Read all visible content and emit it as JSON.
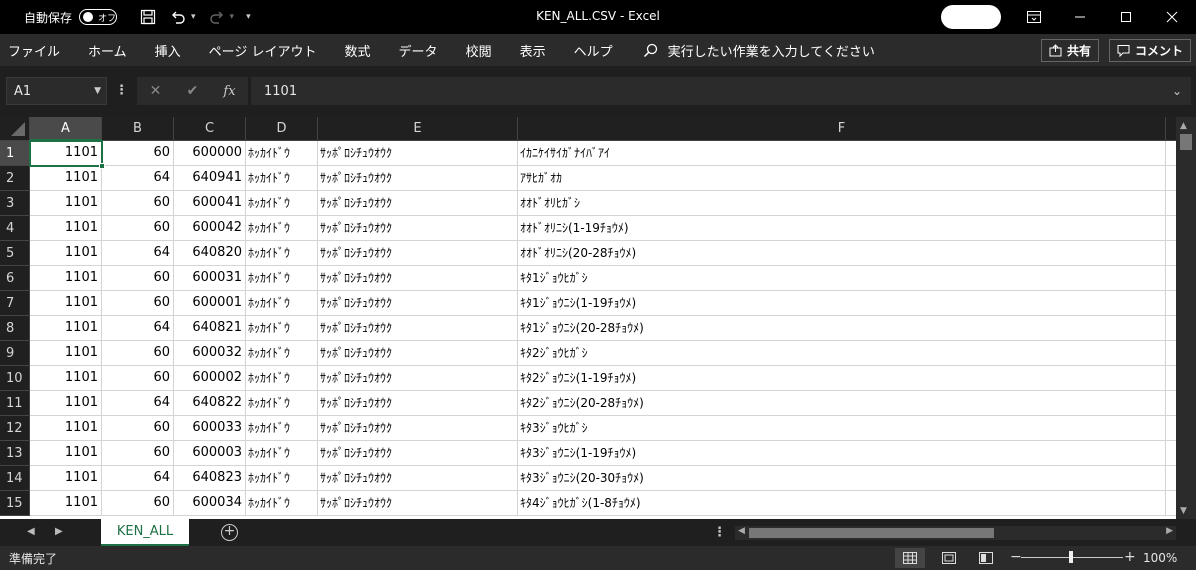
{
  "titlebar": {
    "autosave_label": "自動保存",
    "autosave_state": "オフ",
    "title": "KEN_ALL.CSV  -  Excel",
    "icons": [
      "save-icon",
      "undo-icon",
      "redo-icon",
      "customize-qat-icon",
      "ribbon-display-icon",
      "minimize-icon",
      "maximize-icon",
      "close-icon"
    ]
  },
  "ribbon": {
    "tabs": [
      "ファイル",
      "ホーム",
      "挿入",
      "ページ レイアウト",
      "数式",
      "データ",
      "校閲",
      "表示",
      "ヘルプ"
    ],
    "tell_me": "実行したい作業を入力してください",
    "share_label": "共有",
    "comment_label": "コメント"
  },
  "formula_bar": {
    "name_box": "A1",
    "fx": "fx",
    "value": "1101"
  },
  "columns": [
    "A",
    "B",
    "C",
    "D",
    "E",
    "F"
  ],
  "rows": [
    {
      "n": "1",
      "a": "1101",
      "b": "60",
      "c": "600000",
      "d": "ﾎｯｶｲﾄﾞｳ",
      "e": "ｻｯﾎﾟﾛｼﾁｭｳｵｳｸ",
      "f": "ｲｶﾆｹｲｻｲｶﾞﾅｲﾊﾞｱｲ"
    },
    {
      "n": "2",
      "a": "1101",
      "b": "64",
      "c": "640941",
      "d": "ﾎｯｶｲﾄﾞｳ",
      "e": "ｻｯﾎﾟﾛｼﾁｭｳｵｳｸ",
      "f": "ｱｻﾋｶﾞｵｶ"
    },
    {
      "n": "3",
      "a": "1101",
      "b": "60",
      "c": "600041",
      "d": "ﾎｯｶｲﾄﾞｳ",
      "e": "ｻｯﾎﾟﾛｼﾁｭｳｵｳｸ",
      "f": "ｵｵﾄﾞｵﾘﾋｶﾞｼ"
    },
    {
      "n": "4",
      "a": "1101",
      "b": "60",
      "c": "600042",
      "d": "ﾎｯｶｲﾄﾞｳ",
      "e": "ｻｯﾎﾟﾛｼﾁｭｳｵｳｸ",
      "f": "ｵｵﾄﾞｵﾘﾆｼ(1-19ﾁｮｳﾒ)"
    },
    {
      "n": "5",
      "a": "1101",
      "b": "64",
      "c": "640820",
      "d": "ﾎｯｶｲﾄﾞｳ",
      "e": "ｻｯﾎﾟﾛｼﾁｭｳｵｳｸ",
      "f": "ｵｵﾄﾞｵﾘﾆｼ(20-28ﾁｮｳﾒ)"
    },
    {
      "n": "6",
      "a": "1101",
      "b": "60",
      "c": "600031",
      "d": "ﾎｯｶｲﾄﾞｳ",
      "e": "ｻｯﾎﾟﾛｼﾁｭｳｵｳｸ",
      "f": "ｷﾀ1ｼﾞｮｳﾋｶﾞｼ"
    },
    {
      "n": "7",
      "a": "1101",
      "b": "60",
      "c": "600001",
      "d": "ﾎｯｶｲﾄﾞｳ",
      "e": "ｻｯﾎﾟﾛｼﾁｭｳｵｳｸ",
      "f": "ｷﾀ1ｼﾞｮｳﾆｼ(1-19ﾁｮｳﾒ)"
    },
    {
      "n": "8",
      "a": "1101",
      "b": "64",
      "c": "640821",
      "d": "ﾎｯｶｲﾄﾞｳ",
      "e": "ｻｯﾎﾟﾛｼﾁｭｳｵｳｸ",
      "f": "ｷﾀ1ｼﾞｮｳﾆｼ(20-28ﾁｮｳﾒ)"
    },
    {
      "n": "9",
      "a": "1101",
      "b": "60",
      "c": "600032",
      "d": "ﾎｯｶｲﾄﾞｳ",
      "e": "ｻｯﾎﾟﾛｼﾁｭｳｵｳｸ",
      "f": "ｷﾀ2ｼﾞｮｳﾋｶﾞｼ"
    },
    {
      "n": "10",
      "a": "1101",
      "b": "60",
      "c": "600002",
      "d": "ﾎｯｶｲﾄﾞｳ",
      "e": "ｻｯﾎﾟﾛｼﾁｭｳｵｳｸ",
      "f": "ｷﾀ2ｼﾞｮｳﾆｼ(1-19ﾁｮｳﾒ)"
    },
    {
      "n": "11",
      "a": "1101",
      "b": "64",
      "c": "640822",
      "d": "ﾎｯｶｲﾄﾞｳ",
      "e": "ｻｯﾎﾟﾛｼﾁｭｳｵｳｸ",
      "f": "ｷﾀ2ｼﾞｮｳﾆｼ(20-28ﾁｮｳﾒ)"
    },
    {
      "n": "12",
      "a": "1101",
      "b": "60",
      "c": "600033",
      "d": "ﾎｯｶｲﾄﾞｳ",
      "e": "ｻｯﾎﾟﾛｼﾁｭｳｵｳｸ",
      "f": "ｷﾀ3ｼﾞｮｳﾋｶﾞｼ"
    },
    {
      "n": "13",
      "a": "1101",
      "b": "60",
      "c": "600003",
      "d": "ﾎｯｶｲﾄﾞｳ",
      "e": "ｻｯﾎﾟﾛｼﾁｭｳｵｳｸ",
      "f": "ｷﾀ3ｼﾞｮｳﾆｼ(1-19ﾁｮｳﾒ)"
    },
    {
      "n": "14",
      "a": "1101",
      "b": "64",
      "c": "640823",
      "d": "ﾎｯｶｲﾄﾞｳ",
      "e": "ｻｯﾎﾟﾛｼﾁｭｳｵｳｸ",
      "f": "ｷﾀ3ｼﾞｮｳﾆｼ(20-30ﾁｮｳﾒ)"
    },
    {
      "n": "15",
      "a": "1101",
      "b": "60",
      "c": "600034",
      "d": "ﾎｯｶｲﾄﾞｳ",
      "e": "ｻｯﾎﾟﾛｼﾁｭｳｵｳｸ",
      "f": "ｷﾀ4ｼﾞｮｳﾋｶﾞｼ(1-8ﾁｮｳﾒ)"
    }
  ],
  "sheet_tabs": [
    "KEN_ALL"
  ],
  "status": {
    "ready": "準備完了",
    "zoom": "100%",
    "zoom_level_percent": 100
  },
  "colors": {
    "accent_green": "#1e7145",
    "titlebar_bg": "#000000",
    "ribbon_bg": "#2b2b2b"
  }
}
